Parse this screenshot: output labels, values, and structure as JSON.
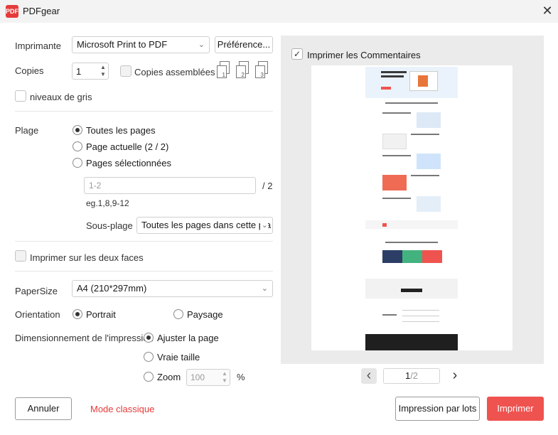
{
  "titlebar": {
    "logo_text": "PDF",
    "title": "PDFgear",
    "close_glyph": "✕"
  },
  "printer": {
    "label": "Imprimante",
    "selected": "Microsoft Print to PDF",
    "preferences_button": "Préférence..."
  },
  "copies": {
    "label": "Copies",
    "value": "1",
    "collate_label": "Copies assemblées",
    "collate_checked": false,
    "sheet_numbers": [
      "1",
      "2",
      "3"
    ]
  },
  "grayscale": {
    "label": "niveaux de gris",
    "checked": false
  },
  "range": {
    "label": "Plage",
    "options": [
      {
        "label": "Toutes les pages",
        "selected": true
      },
      {
        "label": "Page actuelle (2 / 2)",
        "selected": false
      },
      {
        "label": "Pages sélectionnées",
        "selected": false
      }
    ],
    "pages_placeholder": "1-2",
    "total_suffix": "/ 2",
    "example": "eg.1,8,9-12",
    "subrange_label": "Sous-plage",
    "subrange_value": "Toutes les pages dans cette pla"
  },
  "duplex": {
    "label": "Imprimer sur les deux faces",
    "checked": false
  },
  "paper": {
    "label": "PaperSize",
    "value": "A4 (210*297mm)"
  },
  "orientation": {
    "label": "Orientation",
    "options": [
      {
        "label": "Portrait",
        "selected": true
      },
      {
        "label": "Paysage",
        "selected": false
      }
    ]
  },
  "sizing": {
    "label": "Dimensionnement de l'impression",
    "options": [
      {
        "label": "Ajuster la page",
        "selected": true
      },
      {
        "label": "Vraie taille",
        "selected": false
      },
      {
        "label": "Zoom",
        "selected": false
      }
    ],
    "zoom_value": "100",
    "zoom_unit": "%"
  },
  "preview": {
    "comments_label": "Imprimer les Commentaires",
    "comments_checked": true,
    "current_page": "1",
    "page_total": "/2",
    "prev_glyph": "‹",
    "next_glyph": "›"
  },
  "footer": {
    "cancel": "Annuler",
    "classic_mode": "Mode classique",
    "batch": "Impression par lots",
    "print": "Imprimer"
  },
  "colors": {
    "accent": "#ef5350",
    "brand": "#e53b3b"
  }
}
